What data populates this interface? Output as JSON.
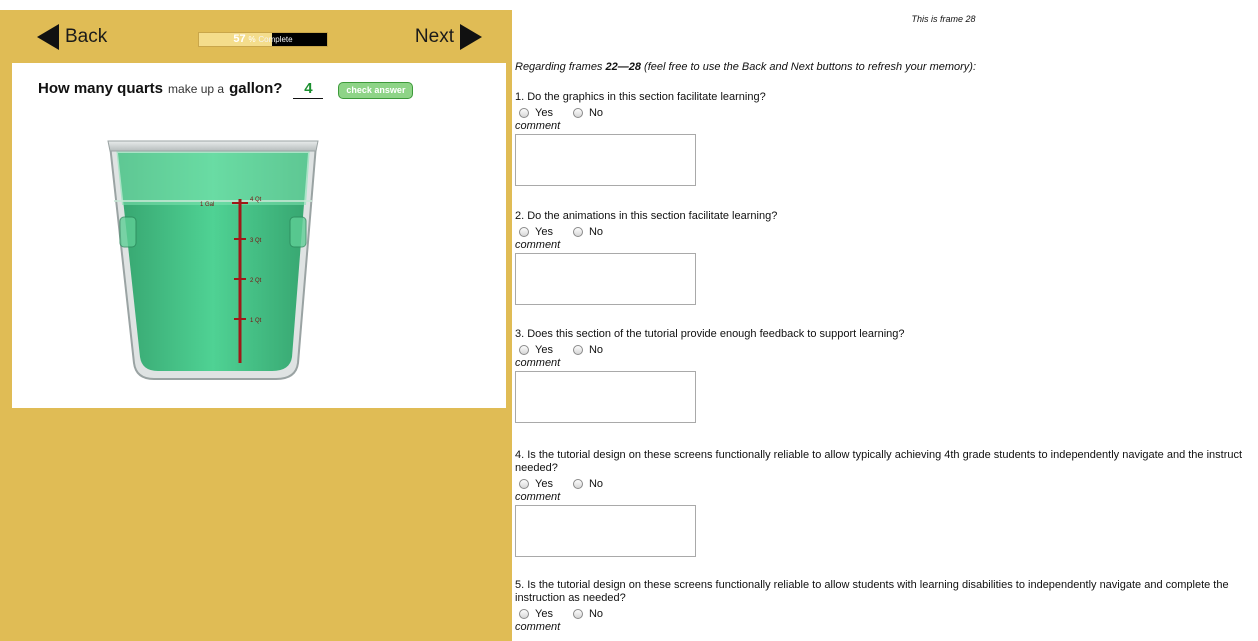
{
  "tutorial": {
    "back_label": "Back",
    "next_label": "Next",
    "progress": {
      "percent_value": 57,
      "percent_text": "57",
      "percent_sign": "%",
      "label": "Complete"
    },
    "question": {
      "part1": "How many quarts",
      "part2": "make up a",
      "part3": "gallon?",
      "answer_value": "4",
      "check_label": "check answer"
    },
    "container_marks": [
      "1 Gal",
      "4 Qt",
      "3 Qt",
      "2 Qt",
      "1 Qt"
    ]
  },
  "survey": {
    "frame_label": "This is frame 28",
    "intro_prefix": "Regarding frames ",
    "intro_range": "22—28",
    "intro_suffix": " (feel free to use the Back and Next buttons to refresh your memory):",
    "yes_label": "Yes",
    "no_label": "No",
    "comment_label": "comment",
    "questions": [
      {
        "text": "1. Do the graphics in this section facilitate learning?"
      },
      {
        "text": "2. Do the animations in this section facilitate learning?"
      },
      {
        "text": "3. Does this section of the tutorial provide enough feedback to support learning?"
      },
      {
        "text": "4. Is the tutorial design on these screens functionally reliable to allow typically achieving 4th grade students to independently navigate and the instruct needed?"
      },
      {
        "text": "5. Is the tutorial design on these screens functionally reliable to allow students with learning disabilities to independently navigate and complete the instruction as needed?"
      }
    ]
  },
  "colors": {
    "panel_gold": "#e0bc55",
    "water_green": "#2fbf7a",
    "measure_red": "#a01818"
  },
  "icons": {
    "back": "triangle-left-icon",
    "next": "triangle-right-icon"
  }
}
